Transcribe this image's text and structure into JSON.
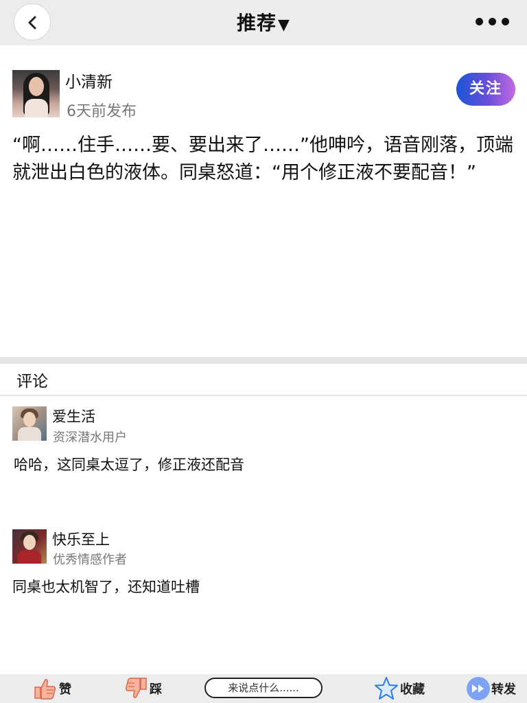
{
  "header": {
    "title": "推荐",
    "title_caret": "▼"
  },
  "post": {
    "author_name": "小清新",
    "published": "6天前发布",
    "follow_label": "关注",
    "body": "“啊……住手……要、要出来了……”他呻吟，语音刚落，顶端就泄出白色的液体。同桌怒道：“用个修正液不要配音！”"
  },
  "comments_section": {
    "title": "评论",
    "items": [
      {
        "name": "爱生活",
        "role": "资深潜水用户",
        "text": "哈哈，这同桌太逗了，修正液还配音"
      },
      {
        "name": "快乐至上",
        "role": "优秀情感作者",
        "text": "同桌也太机智了，还知道吐槽"
      }
    ]
  },
  "bottom_bar": {
    "like_label": "赞",
    "dislike_label": "踩",
    "comment_placeholder": "来说点什么......",
    "favorite_label": "收藏",
    "forward_label": "转发"
  },
  "colors": {
    "follow_gradient_start": "#1b55d8",
    "follow_gradient_end": "#c36be0",
    "bar_background": "#ececec",
    "thumb_accent": "#f08a6b",
    "star_accent": "#2a7de8",
    "forward_accent": "#7ea3f4"
  }
}
